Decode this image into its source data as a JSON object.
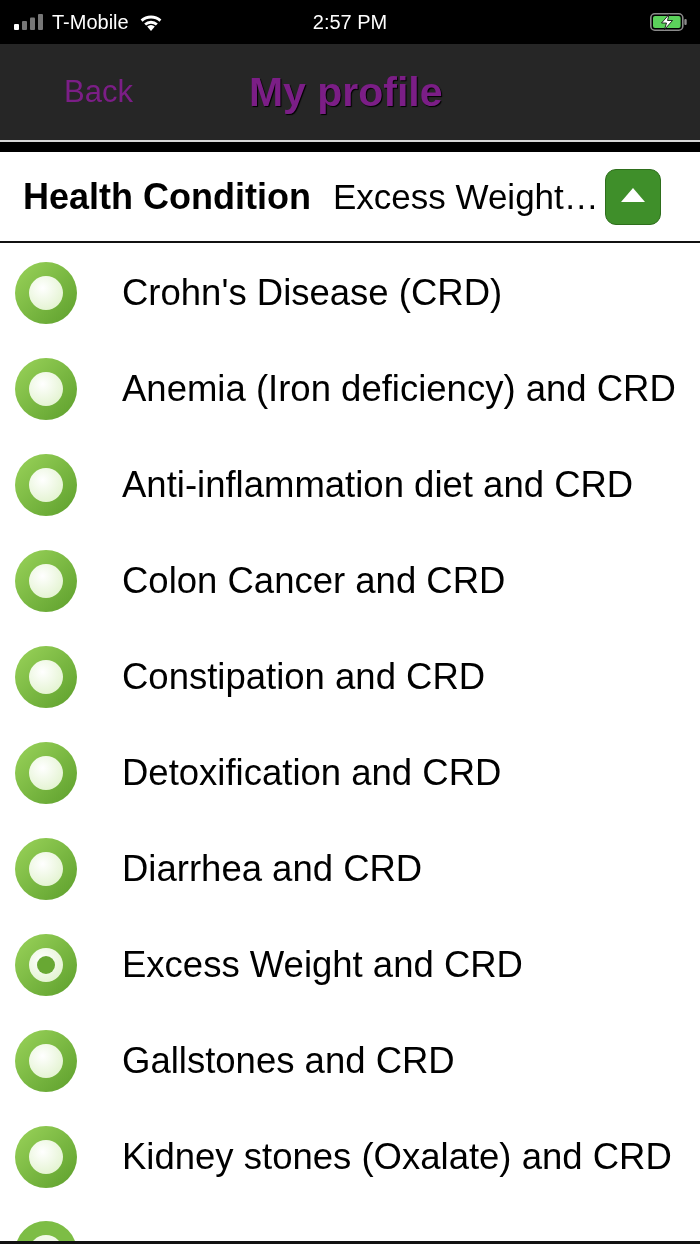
{
  "status_bar": {
    "carrier": "T-Mobile",
    "time": "2:57 PM"
  },
  "nav_bar": {
    "back": "Back",
    "title": "My profile"
  },
  "picker": {
    "label": "Health Condition",
    "value": "Excess Weight…",
    "expanded": true
  },
  "options": [
    {
      "label": "Crohn's Disease (CRD)",
      "selected": false
    },
    {
      "label": "Anemia (Iron deficiency) and CRD",
      "selected": false
    },
    {
      "label": "Anti-inflammation diet and CRD",
      "selected": false
    },
    {
      "label": "Colon Cancer and CRD",
      "selected": false
    },
    {
      "label": "Constipation and CRD",
      "selected": false
    },
    {
      "label": "Detoxification and CRD",
      "selected": false
    },
    {
      "label": "Diarrhea and CRD",
      "selected": false
    },
    {
      "label": "Excess Weight and CRD",
      "selected": true
    },
    {
      "label": "Gallstones and CRD",
      "selected": false
    },
    {
      "label": "Kidney stones (Oxalate) and CRD",
      "selected": false
    }
  ],
  "more_rows_below": true
}
